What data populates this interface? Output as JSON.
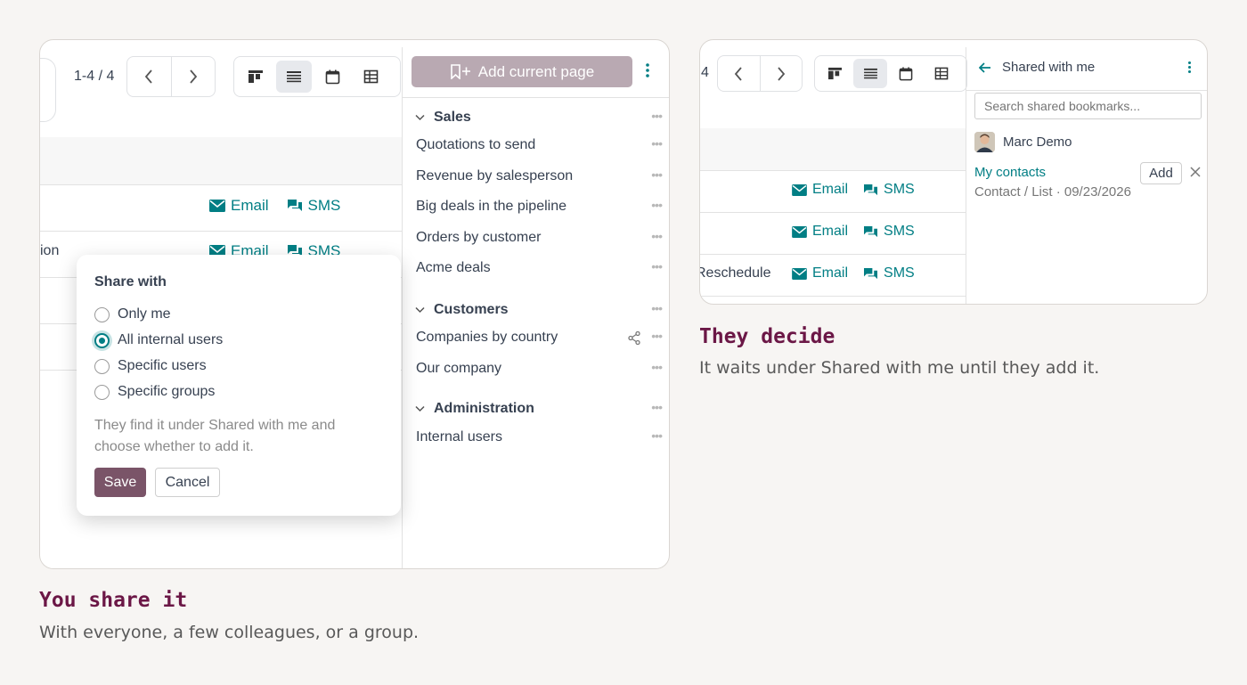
{
  "left_panel": {
    "pager": "1-4 / 4",
    "add_current_page": "Add current page",
    "rows": [
      {
        "fragment": "",
        "email": "Email",
        "sms": "SMS"
      },
      {
        "fragment": "ion",
        "email": "Email",
        "sms": "SMS"
      }
    ],
    "bookmarks": {
      "sections": [
        {
          "name": "Sales",
          "items": [
            "Quotations to send",
            "Revenue by salesperson",
            "Big deals in the pipeline",
            "Orders by customer",
            "Acme deals"
          ]
        },
        {
          "name": "Customers",
          "items": [
            "Companies by country",
            "Our company"
          ]
        },
        {
          "name": "Administration",
          "items": [
            "Internal users"
          ]
        }
      ]
    },
    "share_popup": {
      "title": "Share with",
      "options": [
        "Only me",
        "All internal users",
        "Specific users",
        "Specific groups"
      ],
      "selected": "All internal users",
      "hint": "They find it under Shared with me and choose whether to add it.",
      "save": "Save",
      "cancel": "Cancel"
    }
  },
  "right_panel": {
    "pager_fragment": "4",
    "rows": [
      {
        "fragment": "",
        "email": "Email",
        "sms": "SMS"
      },
      {
        "fragment": "",
        "email": "Email",
        "sms": "SMS"
      },
      {
        "fragment": "Reschedule",
        "email": "Email",
        "sms": "SMS"
      }
    ],
    "shared": {
      "header": "Shared with me",
      "search_placeholder": "Search shared bookmarks...",
      "user": "Marc Demo",
      "bookmark_name": "My contacts",
      "bookmark_meta": "Contact / List · 09/23/2026",
      "add": "Add"
    }
  },
  "captions": {
    "left_title": "You share it",
    "left_sub": "With everyone, a few colleagues, or a group.",
    "right_title": "They decide",
    "right_sub": "It waits under Shared with me until they add it."
  },
  "colors": {
    "accent_teal": "#017e84",
    "brand_plum": "#6b1746",
    "save_button": "#7a5468",
    "add_page_button": "#b9a9b2"
  },
  "icons": [
    "chevron-left-icon",
    "chevron-right-icon",
    "kanban-view-icon",
    "list-view-icon",
    "calendar-view-icon",
    "pivot-view-icon",
    "bookmark-plus-icon",
    "kebab-icon",
    "filter-settings-icon",
    "email-icon",
    "sms-icon",
    "chevron-down-icon",
    "more-dots-icon",
    "share-icon",
    "arrow-left-icon",
    "close-icon",
    "avatar"
  ]
}
